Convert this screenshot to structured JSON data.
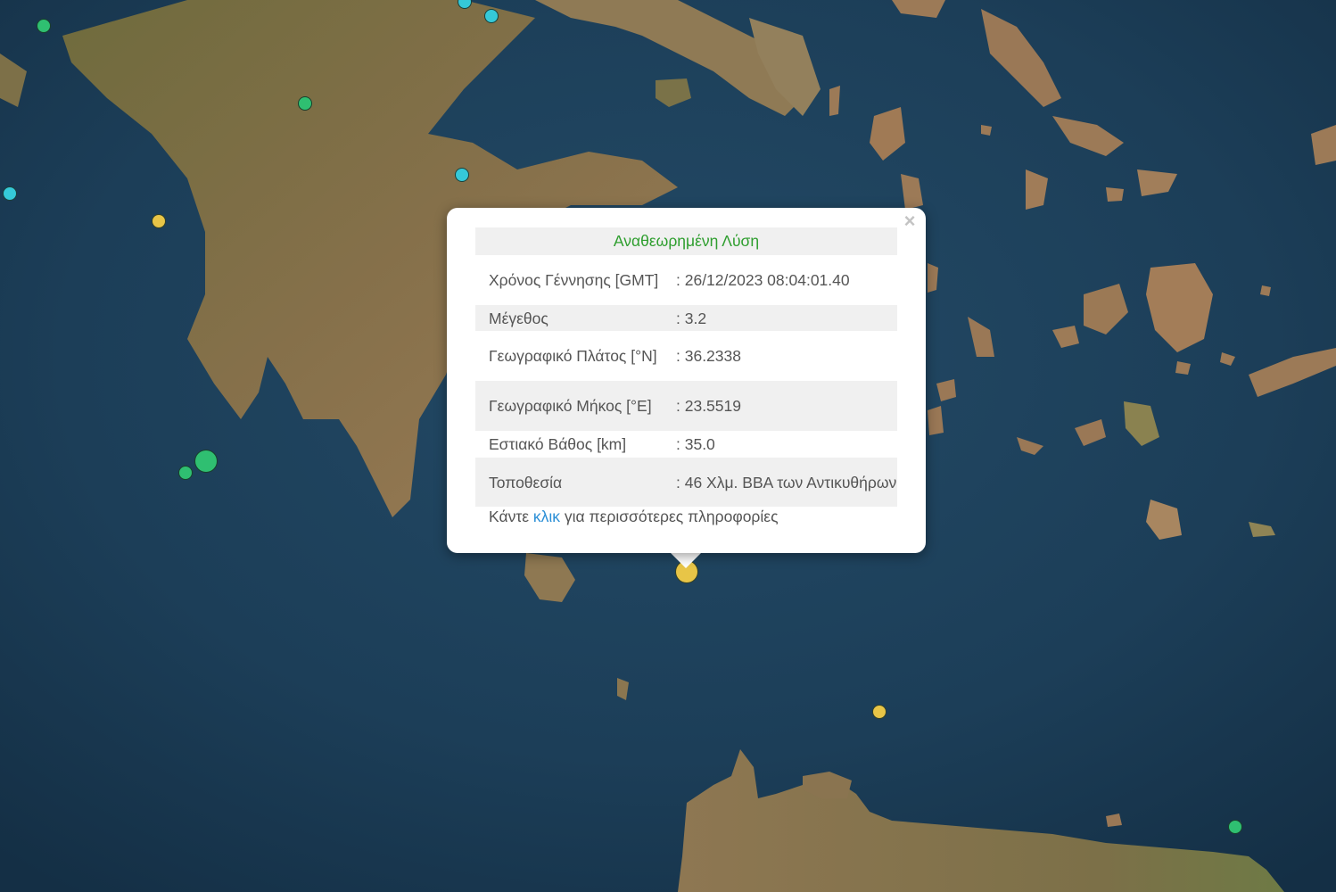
{
  "popup": {
    "header": "Αναθεωρημένη Λύση",
    "close_symbol": "×",
    "rows": [
      {
        "label": "Χρόνος Γέννησης [GMT]",
        "value": ": 26/12/2023 08:04:01.40"
      },
      {
        "label": "Μέγεθος",
        "value": ": 3.2"
      },
      {
        "label": "Γεωγραφικό Πλάτος [°N]",
        "value": ": 36.2338"
      },
      {
        "label": "Γεωγραφικό Μήκος [°E]",
        "value": ": 23.5519"
      },
      {
        "label": "Εστιακό Βάθος [km]",
        "value": ": 35.0"
      },
      {
        "label": "Τοποθεσία",
        "value": ": 46 Χλμ. ΒΒΑ των Αντικυθήρων"
      }
    ],
    "more_prefix": "Κάντε ",
    "more_link": "κλικ",
    "more_suffix": " για περισσότερες πληροφορίες"
  },
  "colors": {
    "sea": "#1d3f5a",
    "land": "#7a6a42",
    "marker_green": "#2fbf71",
    "marker_cyan": "#35c9d8",
    "marker_yellow": "#e8c547",
    "header_green": "#2e9e2e",
    "link_blue": "#2b8fd6"
  }
}
